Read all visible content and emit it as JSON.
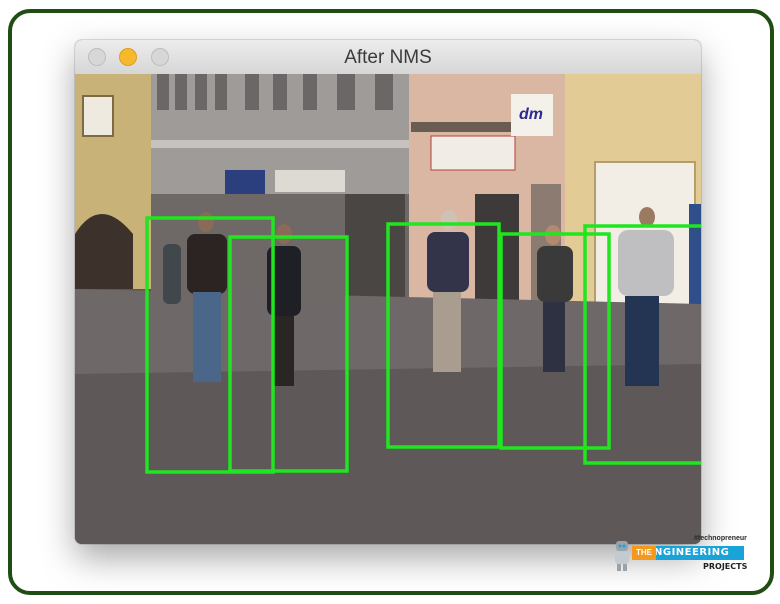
{
  "window": {
    "title": "After NMS"
  },
  "detections": {
    "box_color": "#1fe61f",
    "count": 5
  },
  "watermark": {
    "tagline": "#technopreneur",
    "the": "THE",
    "brand": "ENGINEERING",
    "sub": "PROJECTS"
  }
}
